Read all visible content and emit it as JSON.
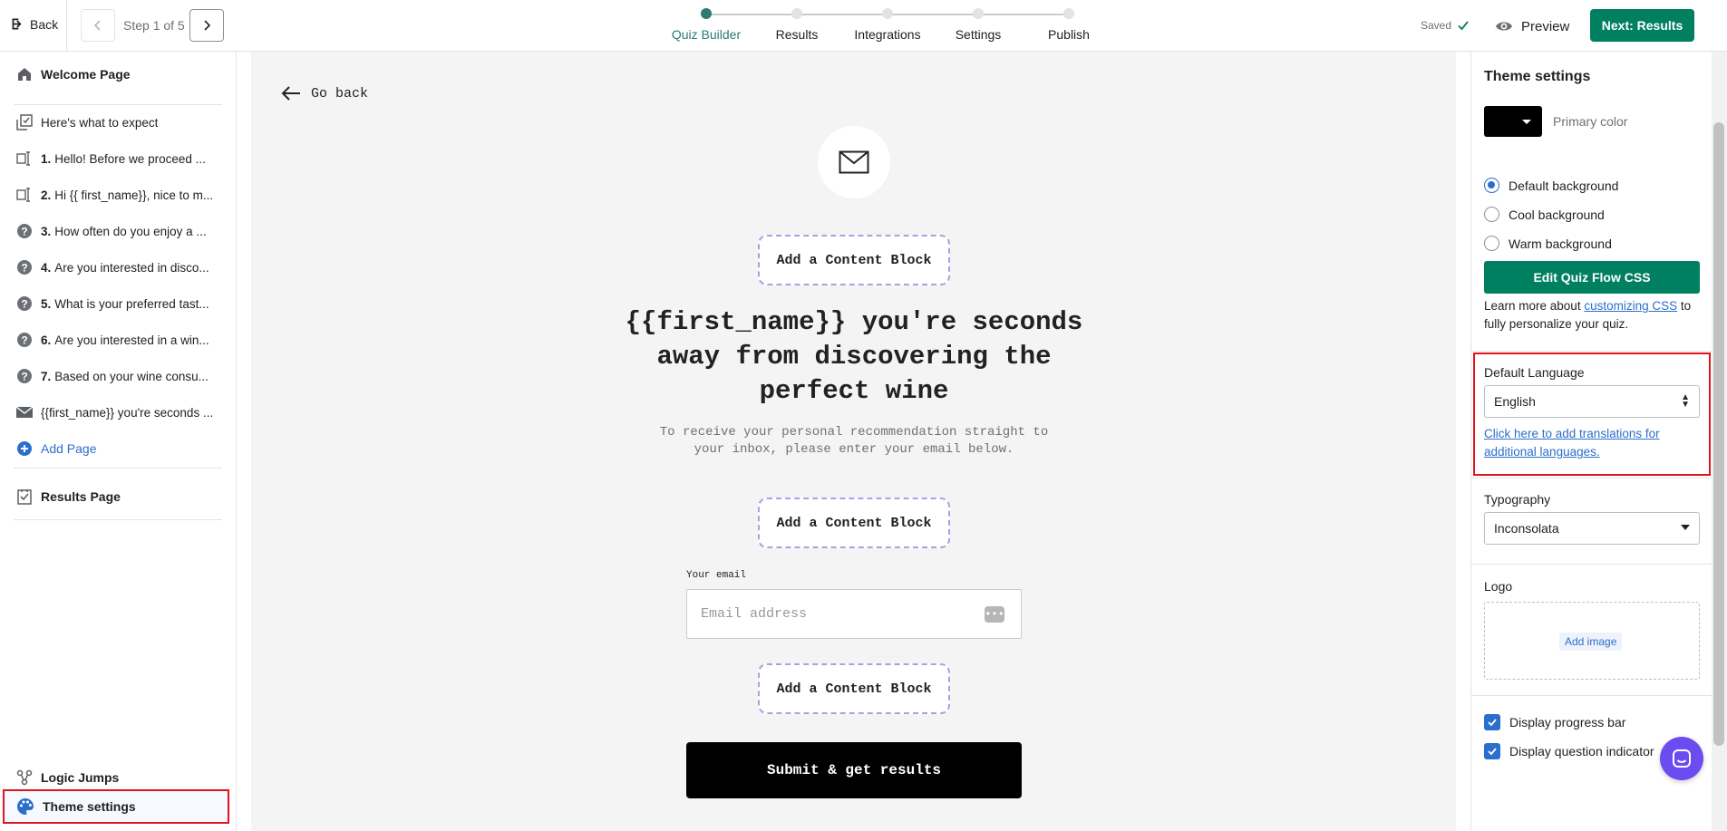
{
  "topbar": {
    "back_label": "Back",
    "step_label": "Step 1 of 5",
    "steps": [
      {
        "label": "Quiz Builder",
        "active": true
      },
      {
        "label": "Results",
        "active": false
      },
      {
        "label": "Integrations",
        "active": false
      },
      {
        "label": "Settings",
        "active": false
      },
      {
        "label": "Publish",
        "active": false
      }
    ],
    "saved_label": "Saved",
    "preview_label": "Preview",
    "next_label": "Next: Results"
  },
  "sidebar": {
    "welcome": "Welcome Page",
    "expect": "Here's what to expect",
    "questions": [
      {
        "num": "1.",
        "text": "Hello! Before we proceed ...",
        "icon": "text-input-icon"
      },
      {
        "num": "2.",
        "text": "Hi {{ first_name}}, nice to m...",
        "icon": "text-input-icon"
      },
      {
        "num": "3.",
        "text": "How often do you enjoy a ...",
        "icon": "question-icon"
      },
      {
        "num": "4.",
        "text": "Are you interested in disco...",
        "icon": "question-icon"
      },
      {
        "num": "5.",
        "text": "What is your preferred tast...",
        "icon": "question-icon"
      },
      {
        "num": "6.",
        "text": "Are you interested in a win...",
        "icon": "question-icon"
      },
      {
        "num": "7.",
        "text": "Based on your wine consu...",
        "icon": "question-icon"
      }
    ],
    "email_page": "{{first_name}} you're seconds ...",
    "add_page": "Add Page",
    "results_page": "Results Page",
    "logic_jumps": "Logic Jumps",
    "theme_settings": "Theme settings"
  },
  "canvas": {
    "go_back": "Go back",
    "content_block_label": "Add a Content Block",
    "headline": "{{first_name}} you're seconds away from discovering the perfect wine",
    "subline": "To receive your personal recommendation straight to your inbox, please enter your email below.",
    "email_label": "Your email",
    "email_placeholder": "Email address",
    "submit_label": "Submit & get results"
  },
  "theme": {
    "title": "Theme settings",
    "primary_color_label": "Primary color",
    "primary_color": "#000000",
    "backgrounds": [
      {
        "label": "Default background",
        "selected": true
      },
      {
        "label": "Cool background",
        "selected": false
      },
      {
        "label": "Warm background",
        "selected": false
      }
    ],
    "edit_css": "Edit Quiz Flow CSS",
    "learn_prefix": "Learn more about ",
    "learn_link": "customizing CSS",
    "learn_suffix": " to fully personalize your quiz.",
    "language_label": "Default Language",
    "language_value": "English",
    "translations_link": "Click here to add translations for additional languages.",
    "typography_label": "Typography",
    "typography_value": "Inconsolata",
    "logo_label": "Logo",
    "add_image": "Add image",
    "progress_bar_label": "Display progress bar",
    "progress_bar_checked": true,
    "question_indicator_label": "Display question indicator",
    "question_indicator_checked": true
  },
  "colors": {
    "accent_green": "#008060",
    "teal_active": "#2e7a74",
    "link_blue": "#2c6ecb",
    "highlight_red": "#e0141e",
    "chat_purple": "#6a4cf0"
  }
}
